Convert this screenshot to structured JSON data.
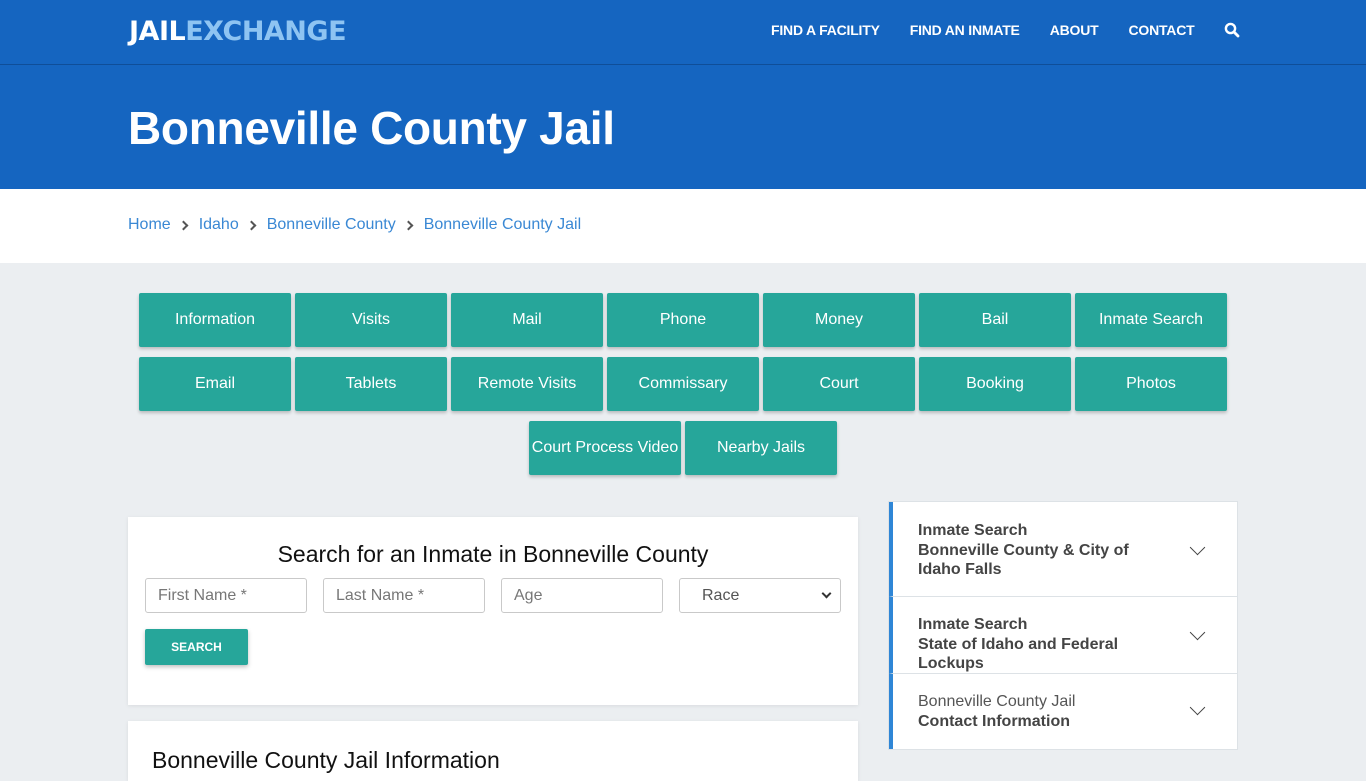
{
  "header": {
    "logo_part1": "JAIL",
    "logo_part2": "EXCHANGE",
    "nav": [
      "FIND A FACILITY",
      "FIND AN INMATE",
      "ABOUT",
      "CONTACT"
    ],
    "search_icon": "search-icon"
  },
  "hero": {
    "title": "Bonneville County Jail"
  },
  "breadcrumb": [
    "Home",
    "Idaho",
    "Bonneville County",
    "Bonneville County Jail"
  ],
  "tiles": [
    "Information",
    "Visits",
    "Mail",
    "Phone",
    "Money",
    "Bail",
    "Inmate Search",
    "Email",
    "Tablets",
    "Remote Visits",
    "Commissary",
    "Court",
    "Booking",
    "Photos",
    "Court Process Video",
    "Nearby Jails"
  ],
  "search": {
    "title": "Search for an Inmate in Bonneville County",
    "first_name_placeholder": "First Name *",
    "last_name_placeholder": "Last Name *",
    "age_placeholder": "Age",
    "race_selected": "Race",
    "button": "SEARCH"
  },
  "info": {
    "title": "Bonneville County Jail Information"
  },
  "accordion": [
    {
      "line1": "Inmate Search",
      "line2": "Bonneville County & City of Idaho Falls"
    },
    {
      "line1": "Inmate Search",
      "line2": "State of Idaho and Federal Lockups"
    },
    {
      "line1": "Bonneville County Jail",
      "line2": "Contact Information"
    }
  ],
  "colors": {
    "brand_blue": "#1565c0",
    "tile_teal": "#26a69a",
    "link_blue": "#3a88d4"
  }
}
